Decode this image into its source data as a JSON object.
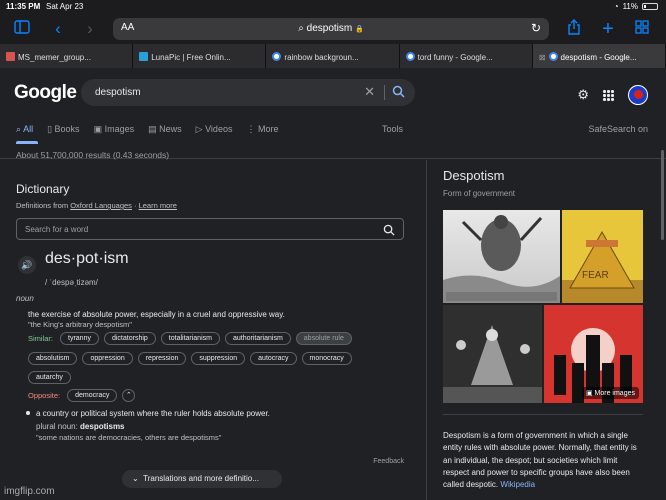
{
  "status": {
    "time": "11:35 PM",
    "date": "Sat Apr 23",
    "battery": "11%"
  },
  "toolbar": {
    "aa": "AA",
    "url": "despotism",
    "lock": "🔒"
  },
  "tabs": [
    {
      "label": "MS_memer_group...",
      "color": "#d9534f"
    },
    {
      "label": "LunaPic | Free Onlin...",
      "color": "#2aa0d8"
    },
    {
      "label": "rainbow backgroun...",
      "color": "#4285f4"
    },
    {
      "label": "tord funny - Google...",
      "color": "#4285f4"
    },
    {
      "label": "despotism - Google...",
      "color": "#4285f4",
      "active": true
    }
  ],
  "google": {
    "logo": "Google",
    "query": "despotism",
    "nav": [
      "All",
      "Books",
      "Images",
      "News",
      "Videos",
      "More"
    ],
    "tools": "Tools",
    "safesearch": "SafeSearch on",
    "results": "About 51,700,000 results (0.43 seconds)"
  },
  "dictionary": {
    "title": "Dictionary",
    "src_prefix": "Definitions from",
    "src_link": "Oxford Languages",
    "src_sep": " · ",
    "learn_more": "Learn more",
    "search_placeholder": "Search for a word",
    "word": "des·pot·ism",
    "ipa": "/ ˈdespəˌtizəm/",
    "pos": "noun",
    "definition1": "the exercise of absolute power, especially in a cruel and oppressive way.",
    "example1": "\"the King's arbitrary despotism\"",
    "similar_label": "Similar:",
    "similar_row1": [
      "tyranny",
      "dictatorship",
      "totalitarianism",
      "authoritarianism",
      "absolute rule"
    ],
    "similar_row2": [
      "absolutism",
      "oppression",
      "repression",
      "suppression",
      "autocracy",
      "monocracy"
    ],
    "similar_row3": [
      "autarchy"
    ],
    "opposite_label": "Opposite:",
    "opposite": [
      "democracy"
    ],
    "definition2": "a country or political system where the ruler holds absolute power.",
    "plural_prefix": "plural noun:",
    "plural_word": "despotisms",
    "example2": "\"some nations are democracies, others are despotisms\"",
    "feedback": "Feedback",
    "more_button": "Translations and more definitio..."
  },
  "knowledge_panel": {
    "title": "Despotism",
    "subtitle": "Form of government",
    "more_images": "More images",
    "image_text": "FEAR",
    "description": "Despotism is a form of government in which a single entity rules with absolute power. Normally, that entity is an individual, the despot; but societies which limit respect and power to specific groups have also been called despotic.",
    "wiki": "Wikipedia"
  },
  "watermark": "imgflip.com"
}
